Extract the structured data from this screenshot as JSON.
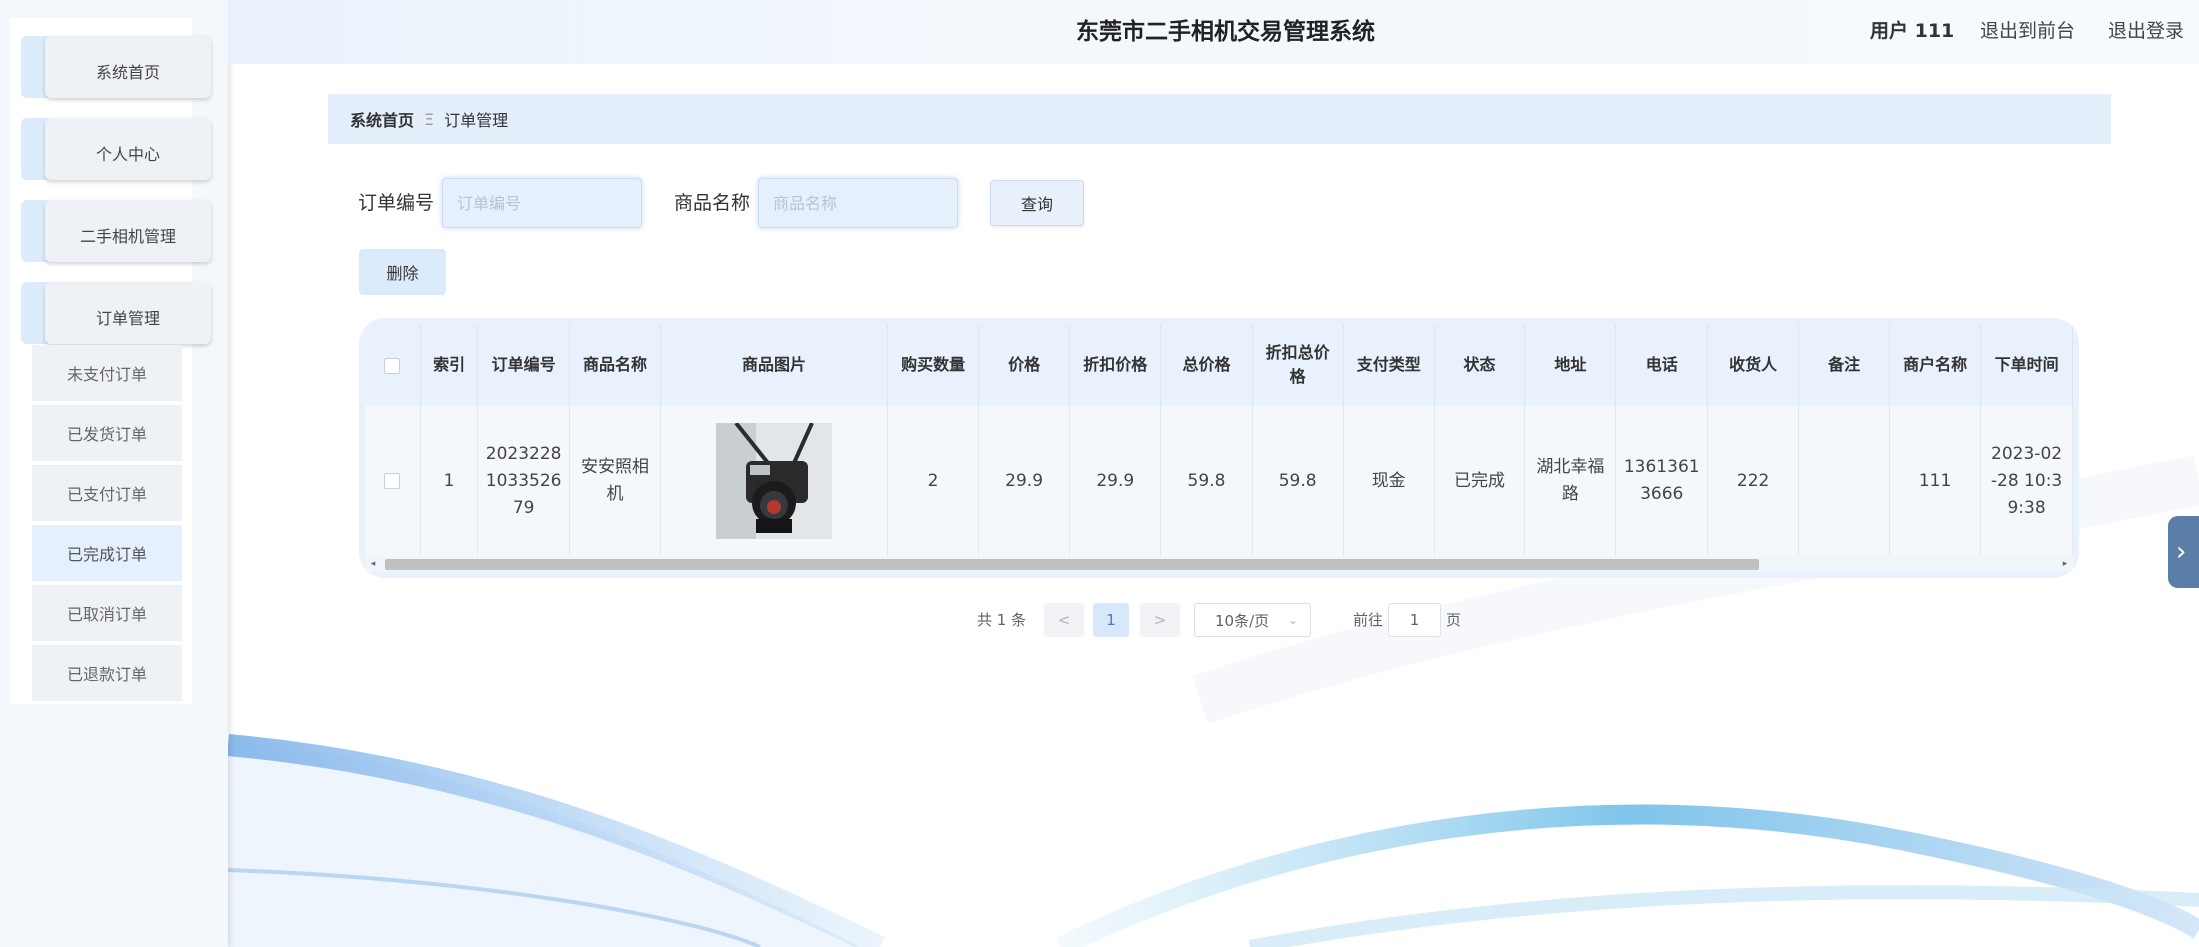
{
  "header": {
    "title": "东莞市二手相机交易管理系统",
    "user_label": "用户 111",
    "to_front": "退出到前台",
    "logout": "退出登录"
  },
  "sidebar": {
    "menu": [
      {
        "label": "系统首页"
      },
      {
        "label": "个人中心"
      },
      {
        "label": "二手相机管理"
      },
      {
        "label": "订单管理"
      }
    ],
    "submenu": [
      {
        "label": "未支付订单"
      },
      {
        "label": "已发货订单"
      },
      {
        "label": "已支付订单"
      },
      {
        "label": "已完成订单",
        "active": true
      },
      {
        "label": "已取消订单"
      },
      {
        "label": "已退款订单"
      }
    ]
  },
  "breadcrumb": {
    "home": "系统首页",
    "separator": "Ξ",
    "current": "订单管理"
  },
  "search": {
    "order_no_label": "订单编号",
    "order_no_placeholder": "订单编号",
    "product_name_label": "商品名称",
    "product_name_placeholder": "商品名称",
    "query_button": "查询"
  },
  "actions": {
    "delete_button": "删除"
  },
  "table": {
    "columns": [
      "索引",
      "订单编号",
      "商品名称",
      "商品图片",
      "购买数量",
      "价格",
      "折扣价格",
      "总价格",
      "折扣总价格",
      "支付类型",
      "状态",
      "地址",
      "电话",
      "收货人",
      "备注",
      "商户名称",
      "下单时间"
    ],
    "rows": [
      {
        "index": "1",
        "order_no": "20232281033526 79",
        "order_no_lines": [
          "2023228",
          "1033526",
          "79"
        ],
        "product_name_lines": [
          "安安照相",
          "机"
        ],
        "image_icon": "camera-photo",
        "quantity": "2",
        "price": "29.9",
        "discount_price": "29.9",
        "total_price": "59.8",
        "discount_total": "59.8",
        "pay_type": "现金",
        "status": "已完成",
        "address_lines": [
          "湖北幸福",
          "路"
        ],
        "phone_lines": [
          "1361361",
          "3666"
        ],
        "receiver": "222",
        "remark": "",
        "merchant": "111",
        "time_lines": [
          "2023-02",
          "-28 10:3",
          "9:38"
        ]
      }
    ]
  },
  "pagination": {
    "total": "共 1 条",
    "prev": "<",
    "current_page": "1",
    "next": ">",
    "page_size": "10条/页",
    "goto_label": "前往",
    "goto_value": "1",
    "page_suffix": "页"
  },
  "side_toggle_icon": "chevron-right-icon"
}
